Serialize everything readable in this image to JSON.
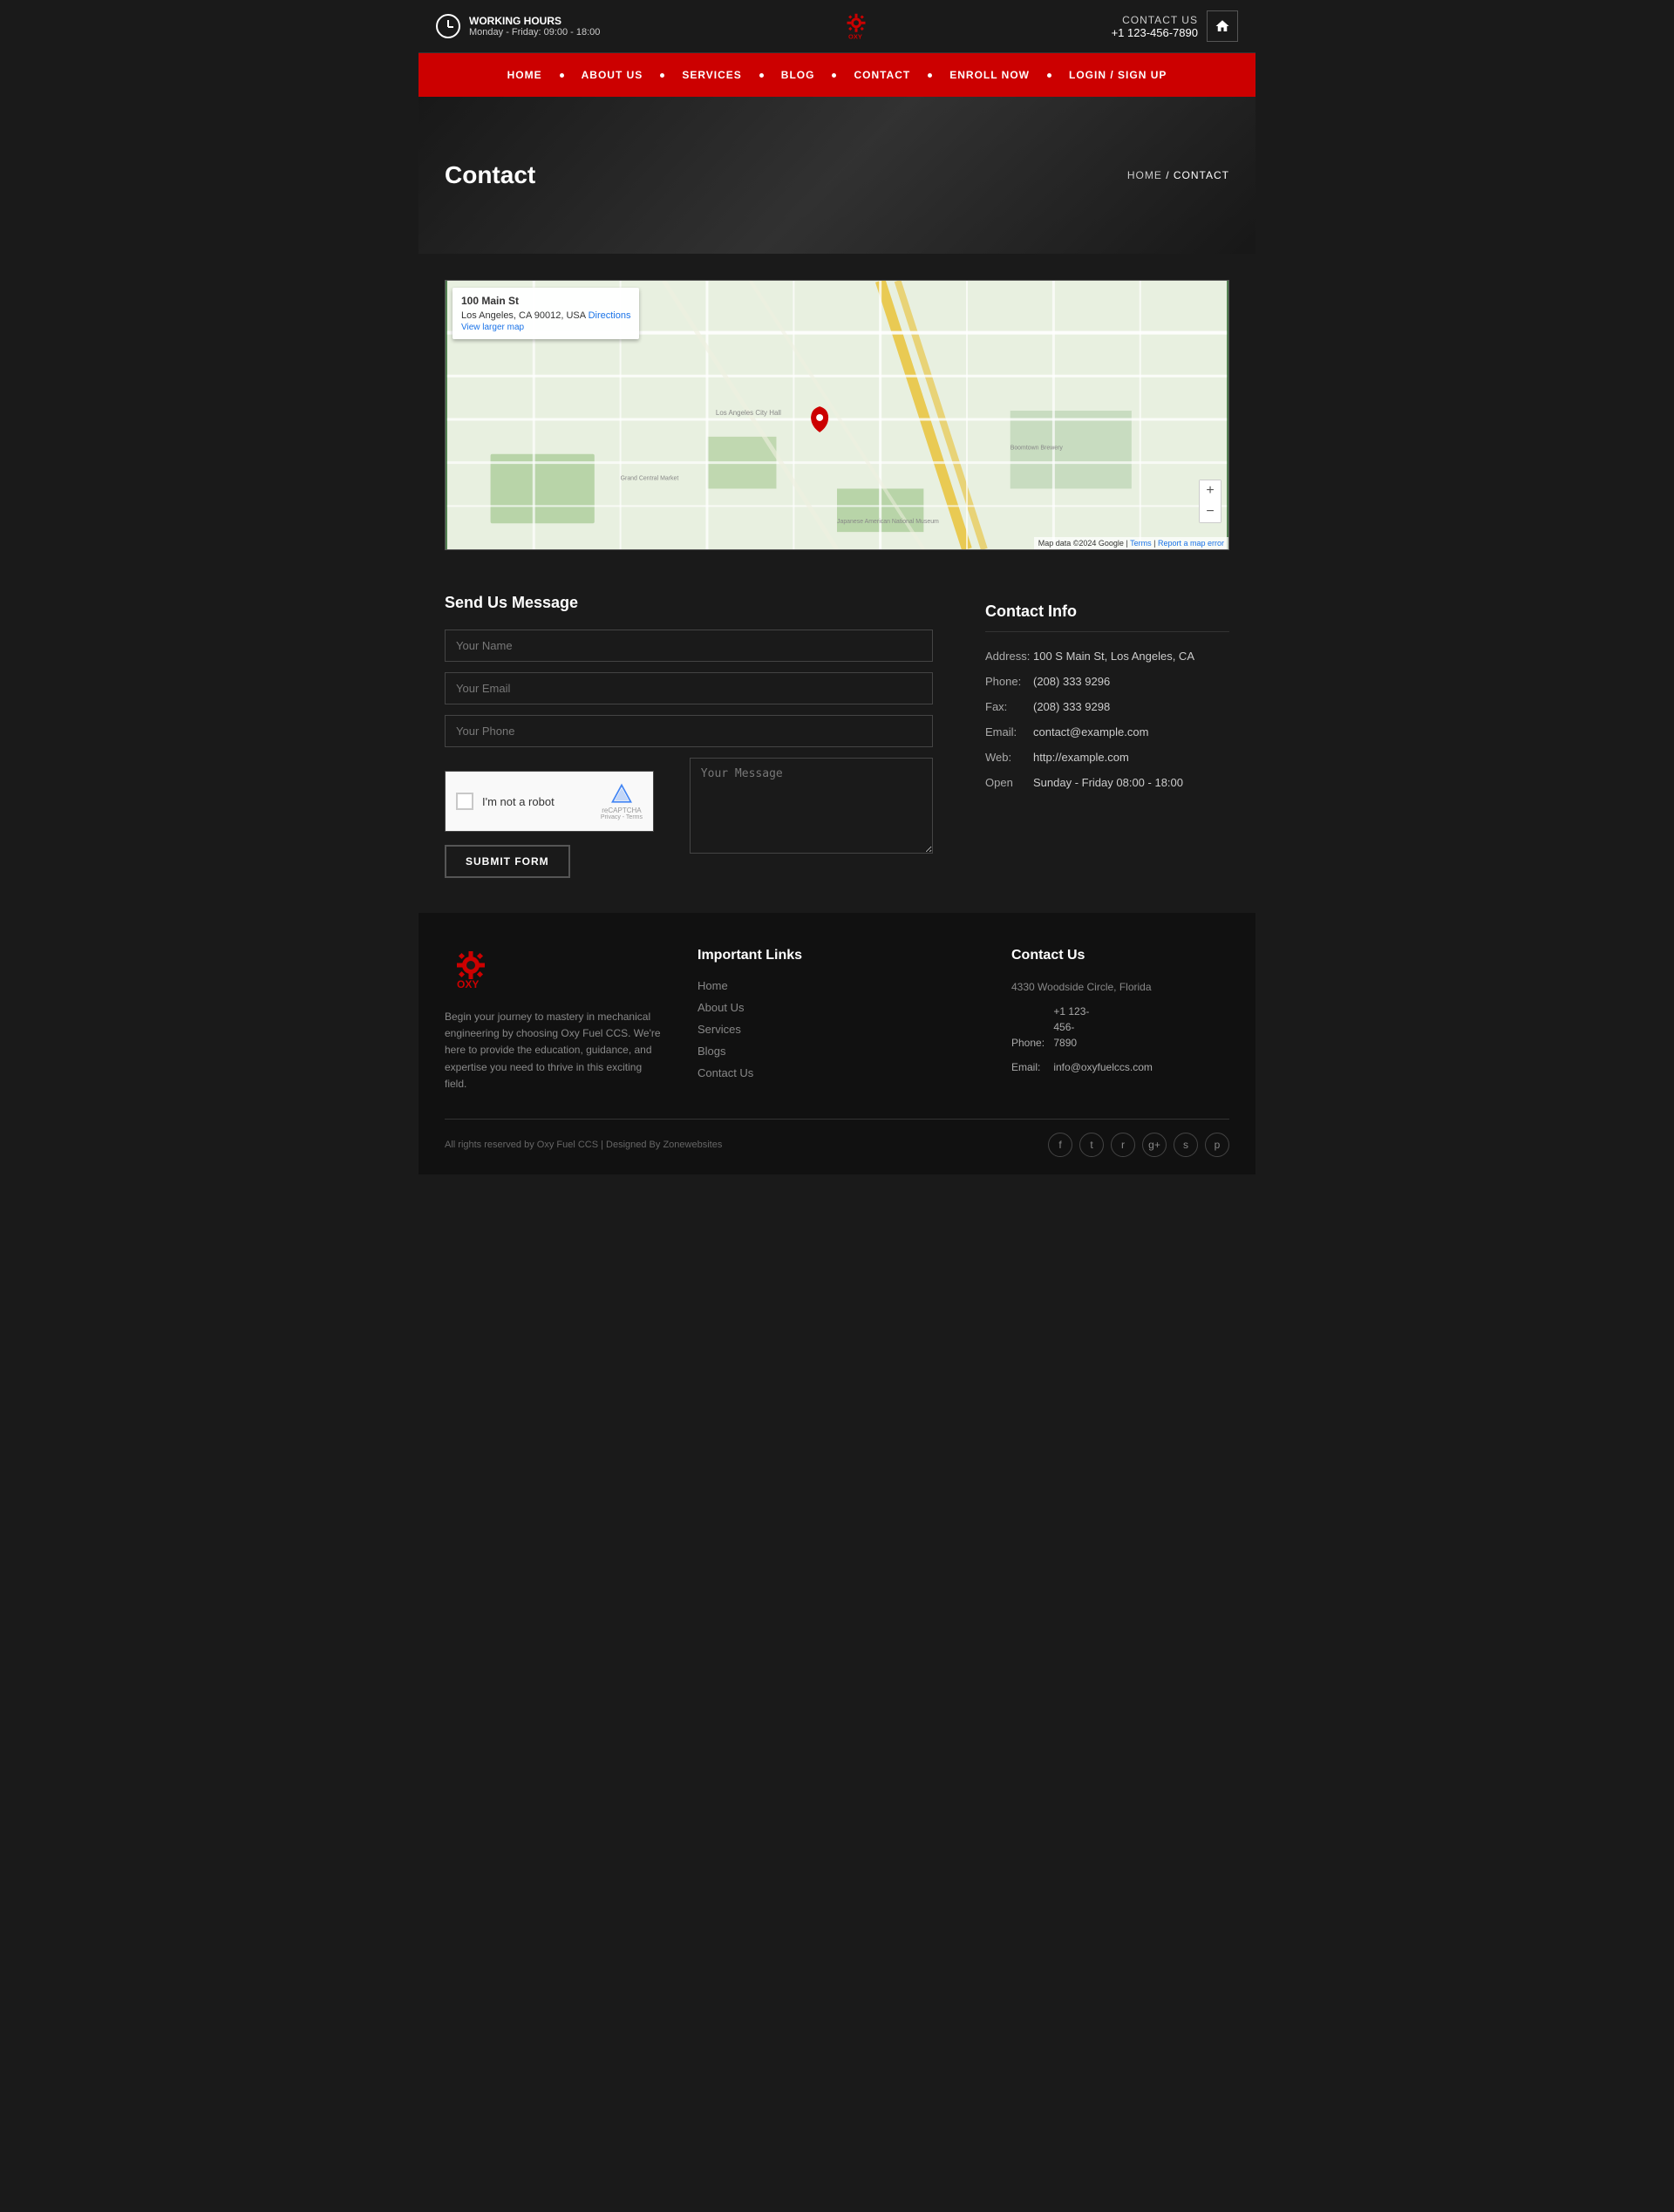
{
  "topbar": {
    "working_hours_label": "WORKING HOURS",
    "working_hours_value": "Monday - Friday: 09:00 - 18:00",
    "contact_label": "CONTACT US",
    "phone": "+1 123-456-7890"
  },
  "logo": {
    "alt": "OXY Fuel CCS Logo"
  },
  "nav": {
    "items": [
      {
        "label": "HOME",
        "href": "#"
      },
      {
        "label": "ABOUT US",
        "href": "#"
      },
      {
        "label": "SERVICES",
        "href": "#"
      },
      {
        "label": "BLOG",
        "href": "#"
      },
      {
        "label": "CONTACT",
        "href": "#"
      },
      {
        "label": "ENROLL NOW",
        "href": "#"
      },
      {
        "label": "LOGIN / SIGN UP",
        "href": "#"
      }
    ]
  },
  "hero": {
    "title": "Contact",
    "breadcrumb_home": "HOME",
    "breadcrumb_current": "CONTACT"
  },
  "map": {
    "address_line1": "100 Main St",
    "address_line2": "Los Angeles, CA 90012, USA",
    "directions_label": "Directions",
    "view_larger_label": "View larger map",
    "footer_text": "Map data ©2024 Google",
    "terms": "Terms",
    "report": "Report a map error"
  },
  "form": {
    "title": "Send Us Message",
    "name_placeholder": "Your Name",
    "email_placeholder": "Your Email",
    "phone_placeholder": "Your Phone",
    "message_placeholder": "Your Message",
    "recaptcha_label": "I'm not a robot",
    "recaptcha_badge": "reCAPTCHA",
    "recaptcha_links": "Privacy - Terms",
    "submit_label": "SUBMIT FORM"
  },
  "contact_info": {
    "title": "Contact Info",
    "address_label": "Address:",
    "address_value": "100 S Main St, Los Angeles, CA",
    "phone_label": "Phone:",
    "phone_value": "(208) 333 9296",
    "fax_label": "Fax:",
    "fax_value": "(208) 333 9298",
    "email_label": "Email:",
    "email_value": "contact@example.com",
    "web_label": "Web:",
    "web_value": "http://example.com",
    "open_label": "Open",
    "open_value": "Sunday - Friday 08:00 - 18:00"
  },
  "footer": {
    "brand": {
      "description": "Begin your journey to mastery in mechanical engineering by choosing Oxy Fuel CCS. We're here to provide the education, guidance, and expertise you need to thrive in this exciting field."
    },
    "links": {
      "title": "Important Links",
      "items": [
        {
          "label": "Home",
          "href": "#"
        },
        {
          "label": "About Us",
          "href": "#"
        },
        {
          "label": "Services",
          "href": "#"
        },
        {
          "label": "Blogs",
          "href": "#"
        },
        {
          "label": "Contact Us",
          "href": "#"
        }
      ]
    },
    "contact": {
      "title": "Contact Us",
      "address": "4330 Woodside Circle, Florida",
      "phone_label": "Phone:",
      "phone_value": "+1 123-456-7890",
      "email_label": "Email:",
      "email_value": "info@oxyfuelccs.com"
    },
    "copyright": "All rights reserved by Oxy Fuel CCS | Designed By Zonewebsites",
    "socials": [
      {
        "name": "facebook",
        "icon": "f"
      },
      {
        "name": "twitter",
        "icon": "t"
      },
      {
        "name": "rss",
        "icon": "r"
      },
      {
        "name": "google-plus",
        "icon": "g+"
      },
      {
        "name": "skype",
        "icon": "s"
      },
      {
        "name": "pinterest",
        "icon": "p"
      }
    ]
  }
}
